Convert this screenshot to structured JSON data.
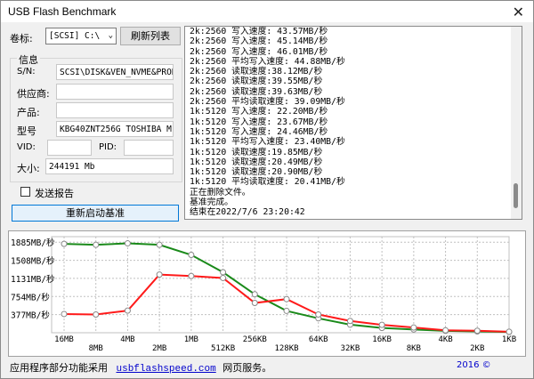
{
  "window": {
    "title": "USB Flash Benchmark"
  },
  "drive": {
    "label": "卷标:",
    "selected": "[SCSI] C:\\",
    "refresh_button": "刷新列表"
  },
  "info": {
    "group_label": "信息",
    "sn_label": "S/N:",
    "sn_value": "SCSI\\DISK&VEN_NVME&PROD_K",
    "vendor_label": "供应商:",
    "vendor_value": "",
    "product_label": "产品:",
    "product_value": "",
    "model_label": "型号",
    "model_value": "KBG40ZNT256G TOSHIBA M",
    "vid_label": "VID:",
    "vid_value": "",
    "pid_label": "PID:",
    "pid_value": "",
    "size_label": "大小:",
    "size_value": "244191 Mb"
  },
  "send_report": {
    "label": "发送报告",
    "checked": false
  },
  "restart_button": "重新启动基准",
  "log_lines": [
    "2k:2560 写入速度: 43.57MB/秒",
    "2k:2560 写入速度: 45.14MB/秒",
    "2k:2560 写入速度: 46.01MB/秒",
    "2k:2560 平均写入速度: 44.88MB/秒",
    "2k:2560 读取速度:38.12MB/秒",
    "2k:2560 读取速度:39.55MB/秒",
    "2k:2560 读取速度:39.63MB/秒",
    "2k:2560 平均读取速度: 39.09MB/秒",
    "1k:5120 写入速度: 22.20MB/秒",
    "1k:5120 写入速度: 23.67MB/秒",
    "1k:5120 写入速度: 24.46MB/秒",
    "1k:5120 平均写入速度: 23.40MB/秒",
    "1k:5120 读取速度:19.85MB/秒",
    "1k:5120 读取速度:20.49MB/秒",
    "1k:5120 读取速度:20.90MB/秒",
    "1k:5120 平均读取速度: 20.41MB/秒",
    "正在删除文件。",
    "基准完成。",
    "结束在2022/7/6 23:20:42"
  ],
  "status": {
    "prefix": "应用程序部分功能采用",
    "link": "usbflashspeed.com",
    "suffix": "网页服务。",
    "right": "2016 ©  "
  },
  "colors": {
    "read": "#1a8a1a",
    "write": "#ff1a1a",
    "grid": "#c0c0c0"
  },
  "chart_data": {
    "type": "line",
    "categories": [
      "16MB",
      "8MB",
      "4MB",
      "2MB",
      "1MB",
      "512KB",
      "256KB",
      "128KB",
      "64KB",
      "32KB",
      "16KB",
      "8KB",
      "4KB",
      "2KB",
      "1KB"
    ],
    "series": [
      {
        "name": "",
        "color": "#1a8a1a",
        "values": [
          1850,
          1830,
          1860,
          1830,
          1620,
          1260,
          800,
          455,
          300,
          168,
          100,
          68,
          40,
          28,
          16
        ]
      },
      {
        "name": "",
        "color": "#ff1a1a",
        "values": [
          390,
          380,
          460,
          1210,
          1180,
          1140,
          620,
          700,
          380,
          245,
          165,
          108,
          50,
          41,
          20
        ]
      }
    ],
    "ytick_labels": [
      "377MB/秒",
      "754MB/秒",
      "1131MB/秒",
      "1508MB/秒",
      "1885MB/秒"
    ],
    "ytick_values": [
      377,
      754,
      1131,
      1508,
      1885
    ],
    "ylim": [
      0,
      2000
    ],
    "grid": true
  }
}
